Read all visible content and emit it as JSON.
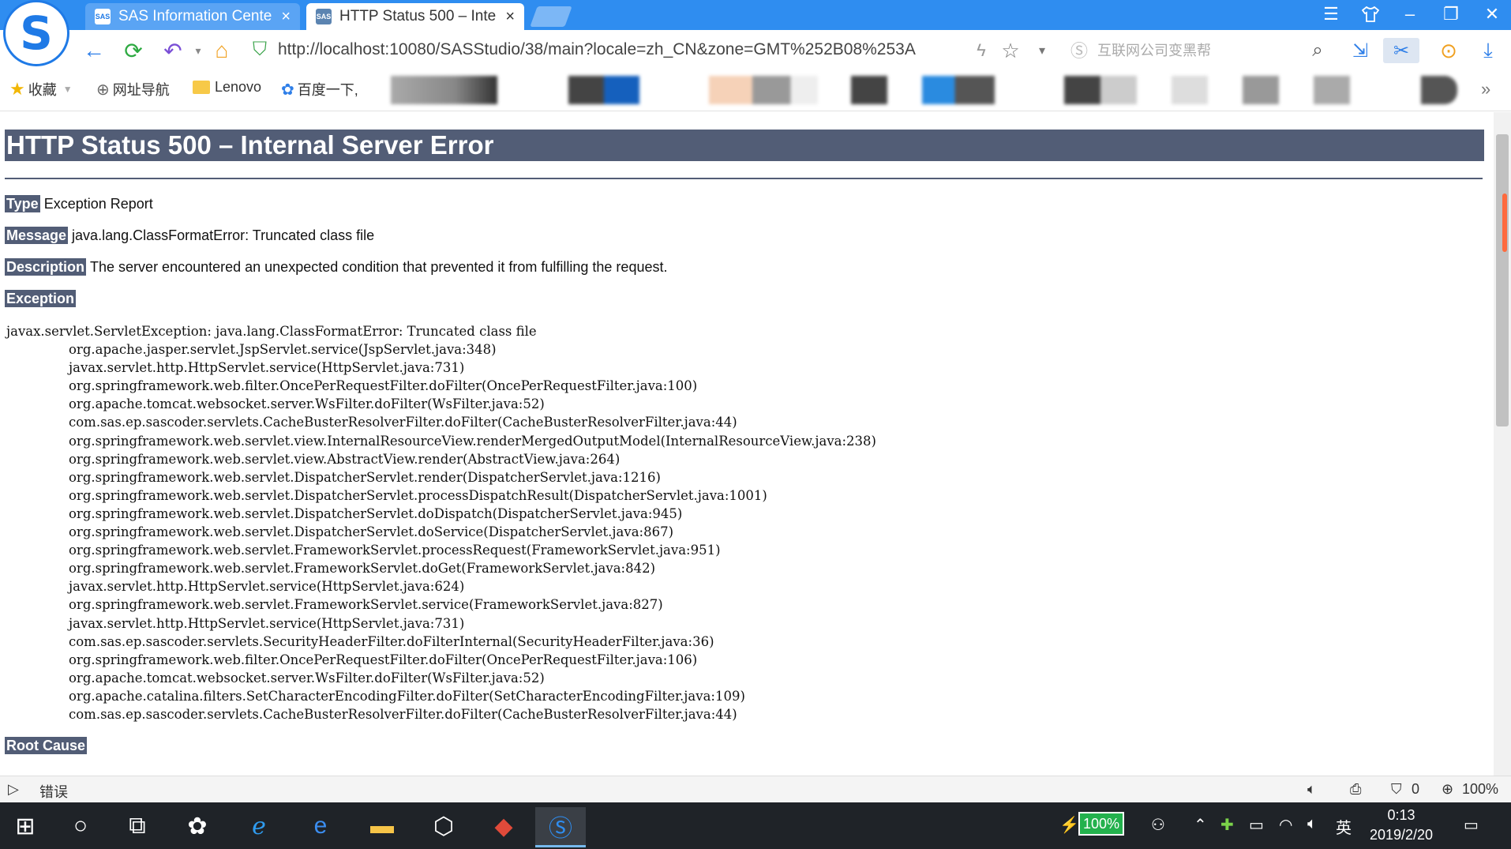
{
  "browser": {
    "tabs": [
      {
        "title": "SAS Information Cente",
        "icon": "sas-favicon-icon",
        "active": false
      },
      {
        "title": "HTTP Status 500 – Inte",
        "icon": "sas-favicon-icon",
        "active": true
      }
    ],
    "favicon_text": "SAS",
    "url": "http://localhost:10080/SASStudio/38/main?locale=zh_CN&zone=GMT%252B08%253A",
    "search_placeholder": "互联网公司变黑帮",
    "bookmarks": [
      {
        "label": "收藏",
        "icon": "star-icon"
      },
      {
        "label": "网址导航",
        "icon": "globe-icon"
      },
      {
        "label": "Lenovo",
        "icon": "folder-icon"
      },
      {
        "label": "百度一下,",
        "icon": "baidu-paw-icon"
      }
    ]
  },
  "page": {
    "heading": "HTTP Status 500 – Internal Server Error",
    "type_label": "Type",
    "type_value": "Exception Report",
    "message_label": "Message",
    "message_value": "java.lang.ClassFormatError: Truncated class file",
    "description_label": "Description",
    "description_value": "The server encountered an unexpected condition that prevented it from fulfilling the request.",
    "exception_label": "Exception",
    "exception_head": "javax.servlet.ServletException: java.lang.ClassFormatError: Truncated class file",
    "stack": [
      "org.apache.jasper.servlet.JspServlet.service(JspServlet.java:348)",
      "javax.servlet.http.HttpServlet.service(HttpServlet.java:731)",
      "org.springframework.web.filter.OncePerRequestFilter.doFilter(OncePerRequestFilter.java:100)",
      "org.apache.tomcat.websocket.server.WsFilter.doFilter(WsFilter.java:52)",
      "com.sas.ep.sascoder.servlets.CacheBusterResolverFilter.doFilter(CacheBusterResolverFilter.java:44)",
      "org.springframework.web.servlet.view.InternalResourceView.renderMergedOutputModel(InternalResourceView.java:238)",
      "org.springframework.web.servlet.view.AbstractView.render(AbstractView.java:264)",
      "org.springframework.web.servlet.DispatcherServlet.render(DispatcherServlet.java:1216)",
      "org.springframework.web.servlet.DispatcherServlet.processDispatchResult(DispatcherServlet.java:1001)",
      "org.springframework.web.servlet.DispatcherServlet.doDispatch(DispatcherServlet.java:945)",
      "org.springframework.web.servlet.DispatcherServlet.doService(DispatcherServlet.java:867)",
      "org.springframework.web.servlet.FrameworkServlet.processRequest(FrameworkServlet.java:951)",
      "org.springframework.web.servlet.FrameworkServlet.doGet(FrameworkServlet.java:842)",
      "javax.servlet.http.HttpServlet.service(HttpServlet.java:624)",
      "org.springframework.web.servlet.FrameworkServlet.service(FrameworkServlet.java:827)",
      "javax.servlet.http.HttpServlet.service(HttpServlet.java:731)",
      "com.sas.ep.sascoder.servlets.SecurityHeaderFilter.doFilterInternal(SecurityHeaderFilter.java:36)",
      "org.springframework.web.filter.OncePerRequestFilter.doFilter(OncePerRequestFilter.java:106)",
      "org.apache.tomcat.websocket.server.WsFilter.doFilter(WsFilter.java:52)",
      "org.apache.catalina.filters.SetCharacterEncodingFilter.doFilter(SetCharacterEncodingFilter.java:109)",
      "com.sas.ep.sascoder.servlets.CacheBusterResolverFilter.doFilter(CacheBusterResolverFilter.java:44)"
    ],
    "root_cause_label": "Root Cause"
  },
  "statusbar": {
    "text": "错误",
    "blocked_count": "0",
    "zoom": "100%"
  },
  "taskbar": {
    "battery": "100%",
    "ime": "英",
    "time": "0:13",
    "date": "2019/2/20"
  },
  "colors": {
    "accent": "#2f8df0",
    "heading_bg": "#525d76",
    "taskbar": "#1f2328"
  }
}
